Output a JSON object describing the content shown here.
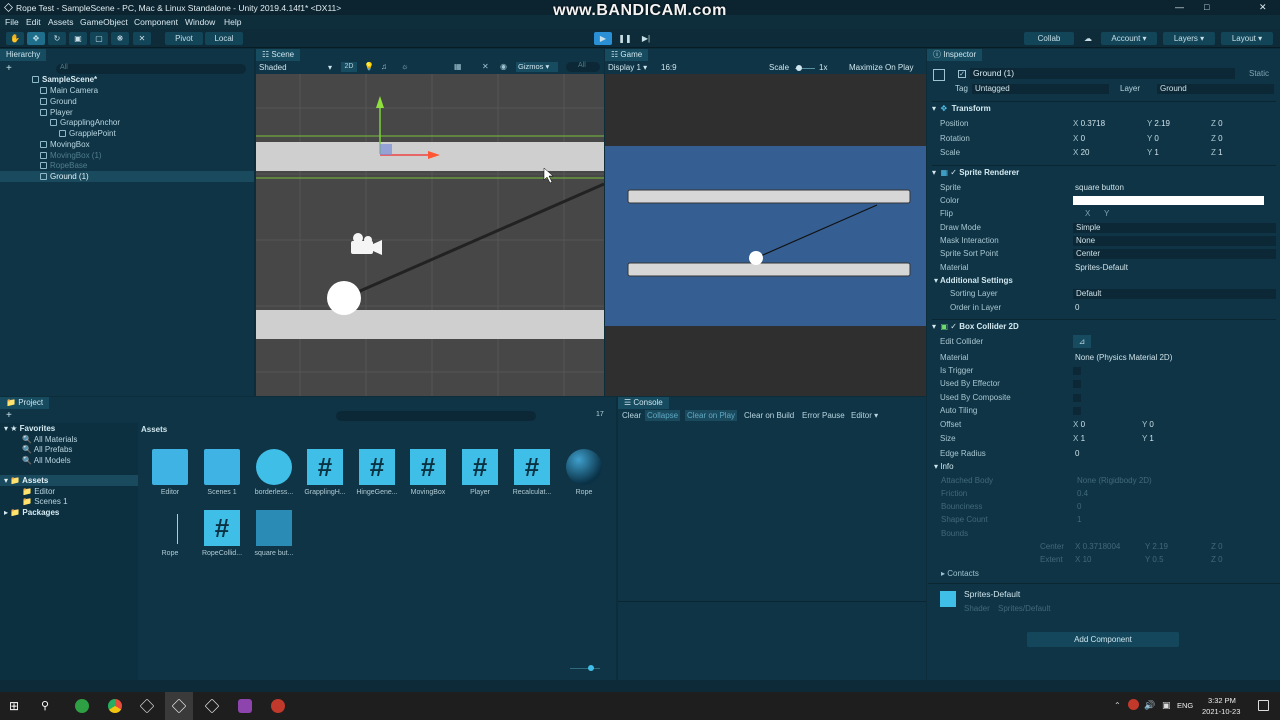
{
  "window": {
    "title": "Rope Test - SampleScene - PC, Mac & Linux Standalone - Unity 2019.4.14f1* <DX11>",
    "watermark": "www.BANDICAM.com"
  },
  "menu": [
    "File",
    "Edit",
    "Assets",
    "GameObject",
    "Component",
    "Window",
    "Help"
  ],
  "toolbar": {
    "pivot": "Pivot",
    "local": "Local",
    "collab": "Collab",
    "account": "Account",
    "layers": "Layers",
    "layout": "Layout"
  },
  "hierarchy": {
    "tab": "Hierarchy",
    "search_placeholder": "All",
    "items": [
      {
        "label": "SampleScene*"
      },
      {
        "label": "Main Camera"
      },
      {
        "label": "Ground"
      },
      {
        "label": "Player"
      },
      {
        "label": "GrapplingAnchor"
      },
      {
        "label": "GrapplePoint"
      },
      {
        "label": "MovingBox"
      },
      {
        "label": "MovingBox (1)"
      },
      {
        "label": "RopeBase"
      },
      {
        "label": "Ground (1)"
      }
    ]
  },
  "scene": {
    "tab": "Scene",
    "shading": "Shaded",
    "mode2d": "2D",
    "gizmos": "Gizmos",
    "all": "All"
  },
  "game": {
    "tab": "Game",
    "display": "Display 1",
    "aspect": "16:9",
    "scale_label": "Scale",
    "scale_value": "1x",
    "maximize": "Maximize On Play"
  },
  "inspector": {
    "tab": "Inspector",
    "object_name": "Ground (1)",
    "static": "Static",
    "tag_label": "Tag",
    "tag": "Untagged",
    "layer_label": "Layer",
    "layer": "Ground",
    "transform": {
      "title": "Transform",
      "position_label": "Position",
      "position": {
        "x": "0.3718",
        "y": "2.19",
        "z": "0"
      },
      "rotation_label": "Rotation",
      "rotation": {
        "x": "0",
        "y": "0",
        "z": "0"
      },
      "scale_label": "Scale",
      "scale": {
        "x": "20",
        "y": "1",
        "z": "1"
      }
    },
    "sprite_renderer": {
      "title": "Sprite Renderer",
      "sprite_label": "Sprite",
      "sprite": "square button",
      "color_label": "Color",
      "flip_label": "Flip",
      "flip_x": "X",
      "flip_y": "Y",
      "draw_mode_label": "Draw Mode",
      "draw_mode": "Simple",
      "mask_label": "Mask Interaction",
      "mask": "None",
      "sort_point_label": "Sprite Sort Point",
      "sort_point": "Center",
      "material_label": "Material",
      "material": "Sprites-Default",
      "additional": "Additional Settings",
      "sorting_layer_label": "Sorting Layer",
      "sorting_layer": "Default",
      "order_label": "Order in Layer",
      "order": "0"
    },
    "box_collider": {
      "title": "Box Collider 2D",
      "edit_label": "Edit Collider",
      "material_label": "Material",
      "material": "None (Physics Material 2D)",
      "trigger_label": "Is Trigger",
      "effector_label": "Used By Effector",
      "composite_label": "Used By Composite",
      "autotiling_label": "Auto Tiling",
      "offset_label": "Offset",
      "offset": {
        "x": "0",
        "y": "0"
      },
      "size_label": "Size",
      "size": {
        "x": "1",
        "y": "1"
      },
      "edge_label": "Edge Radius",
      "edge": "0",
      "info_label": "Info",
      "attached_label": "Attached Body",
      "attached": "None (Rigidbody 2D)",
      "friction_label": "Friction",
      "friction": "0.4",
      "bounciness_label": "Bounciness",
      "bounciness": "0",
      "shape_label": "Shape Count",
      "shape": "1",
      "bounds_label": "Bounds",
      "center_label": "Center",
      "center": {
        "x": "0.3718004",
        "y": "2.19",
        "z": "0"
      },
      "extent_label": "Extent",
      "extent": {
        "x": "10",
        "y": "0.5",
        "z": "0"
      },
      "contacts_label": "Contacts"
    },
    "material_preview": {
      "name": "Sprites-Default",
      "shader_label": "Shader",
      "shader": "Sprites/Default"
    },
    "add_component": "Add Component"
  },
  "project": {
    "tab": "Project",
    "favorites": "Favorites",
    "fav_items": [
      "All Materials",
      "All Prefabs",
      "All Models"
    ],
    "assets_root": "Assets",
    "folders": [
      "Editor",
      "Scenes 1"
    ],
    "packages": "Packages",
    "breadcrumb": "Assets",
    "count": "17",
    "assets": [
      {
        "name": "Editor",
        "kind": "folder"
      },
      {
        "name": "Scenes 1",
        "kind": "folder"
      },
      {
        "name": "borderless...",
        "kind": "circle"
      },
      {
        "name": "GrapplingH...",
        "kind": "script"
      },
      {
        "name": "HingeGene...",
        "kind": "script"
      },
      {
        "name": "MovingBox",
        "kind": "script"
      },
      {
        "name": "Player",
        "kind": "script"
      },
      {
        "name": "Recalculat...",
        "kind": "script"
      },
      {
        "name": "Rope",
        "kind": "sphere"
      },
      {
        "name": "Rope",
        "kind": "prefab"
      },
      {
        "name": "RopeCollid...",
        "kind": "script"
      },
      {
        "name": "square but...",
        "kind": "square"
      }
    ]
  },
  "console": {
    "tab": "Console",
    "buttons": [
      "Clear",
      "Collapse",
      "Clear on Play",
      "Clear on Build",
      "Error Pause",
      "Editor"
    ]
  },
  "taskbar": {
    "time": "3:32 PM",
    "date": "2021-10-23",
    "lang": "ENG"
  },
  "colors": {
    "accent": "#3fbfe8",
    "panel": "#0f3445",
    "game_bg": "#355f93"
  }
}
